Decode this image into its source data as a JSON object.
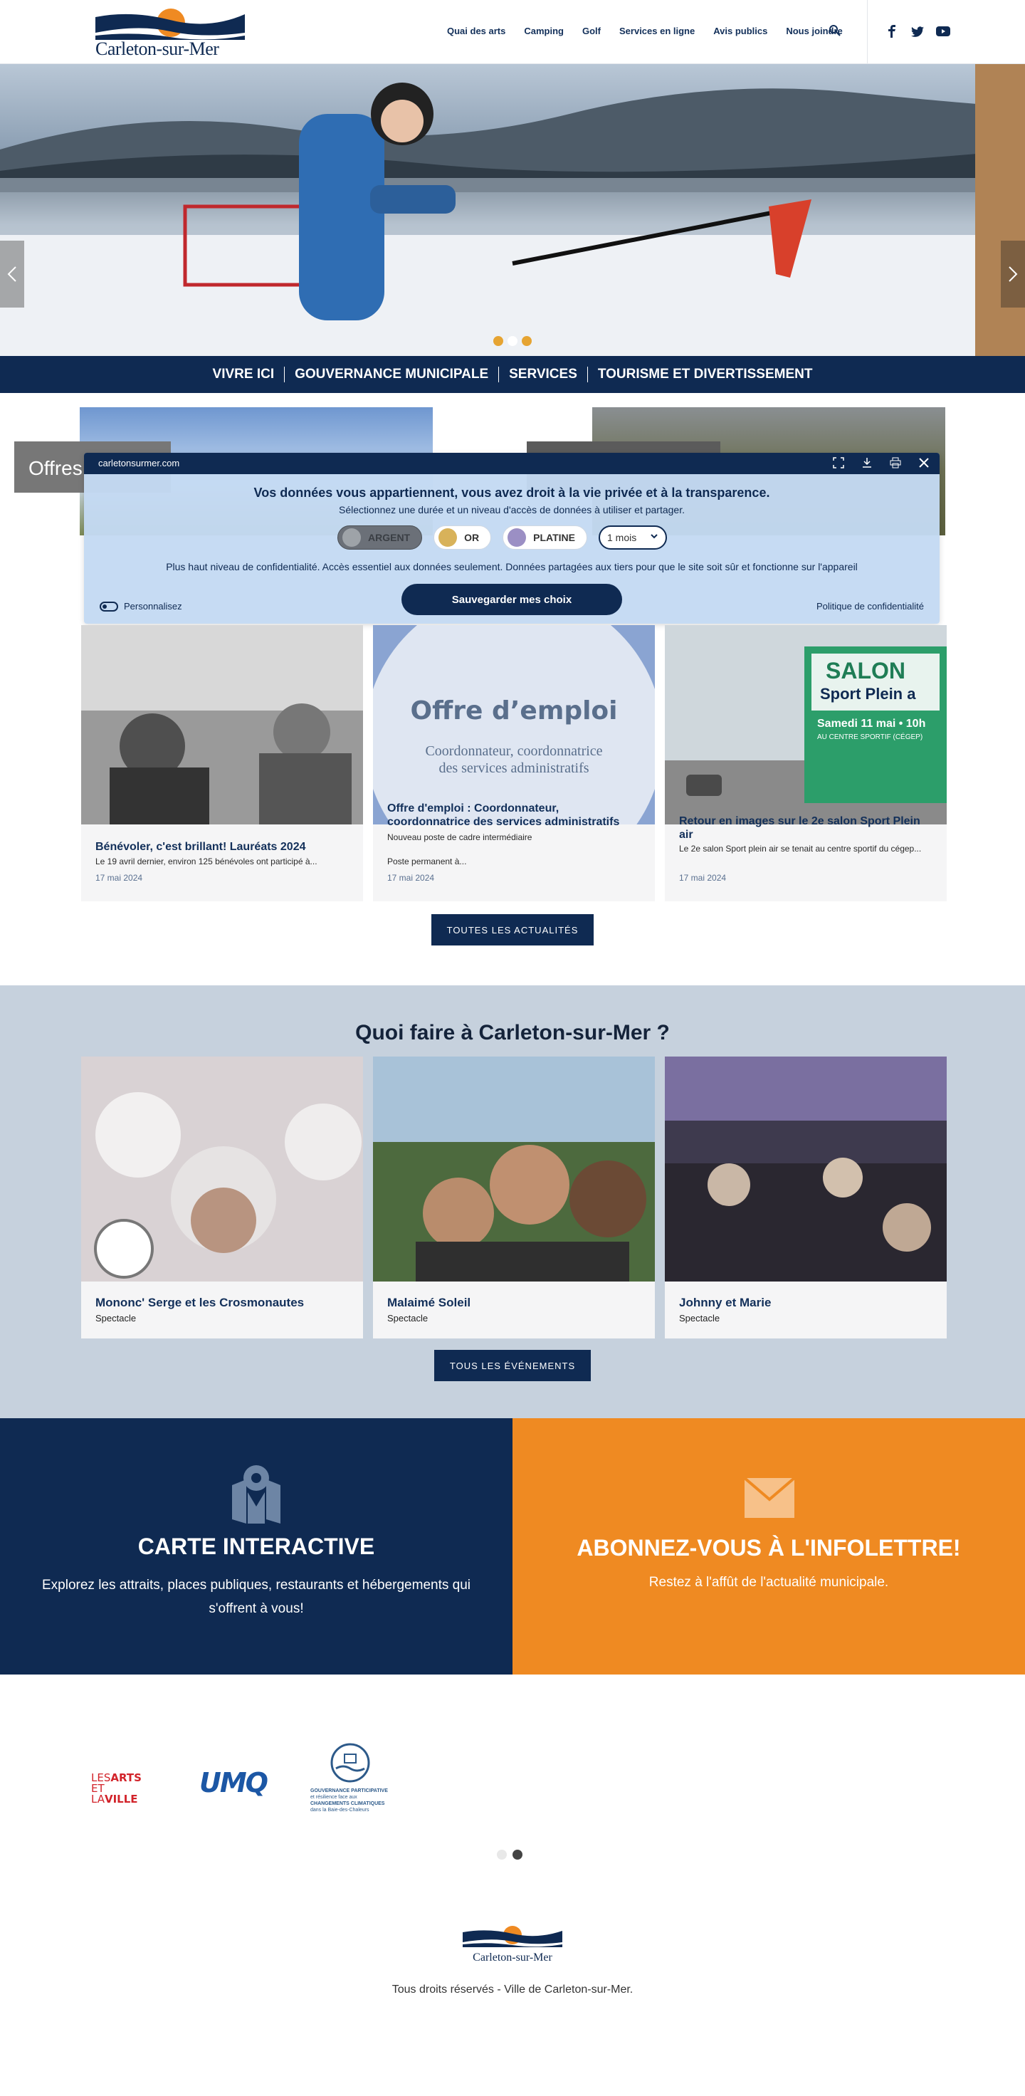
{
  "header": {
    "logo_text": "Carleton-sur-Mer",
    "nav": [
      "Quai des arts",
      "Camping",
      "Golf",
      "Services en ligne",
      "Avis publics",
      "Nous joindre"
    ],
    "social_icons": [
      "facebook-icon",
      "twitter-icon",
      "youtube-icon"
    ]
  },
  "hero": {
    "slides": 3,
    "active_slide": 2
  },
  "main_nav": [
    "VIVRE ICI",
    "GOUVERNANCE MUNICIPALE",
    "SERVICES",
    "TOURISME ET DIVERTISSEMENT"
  ],
  "offers": {
    "left_label": "Offres"
  },
  "cookie": {
    "domain": "carletonsurmer.com",
    "heading": "Vos données vous appartiennent, vous avez droit à la vie privée et à la transparence.",
    "subheading": "Sélectionnez une durée et un niveau d'accès de données à utiliser et partager.",
    "levels": [
      {
        "label": "ARGENT",
        "color": "#9ea3a8",
        "selected": true
      },
      {
        "label": "OR",
        "color": "#d8b25a",
        "selected": false
      },
      {
        "label": "PLATINE",
        "color": "#9b8fc4",
        "selected": false
      }
    ],
    "period": "1 mois",
    "description": "Plus haut niveau de confidentialité. Accès essentiel aux données seulement. Données partagées aux tiers pour que le site soit sûr et fonctionne sur l'appareil",
    "save_label": "Sauvegarder mes choix",
    "customize_label": "Personnalisez",
    "policy_label": "Politique de confidentialité"
  },
  "news": {
    "items": [
      {
        "title": "Bénévoler, c'est brillant! Lauréats 2024",
        "excerpt": "Le 19 avril dernier, environ 125 bénévoles ont participé à...",
        "date": "17 mai 2024"
      },
      {
        "title": "Offre d'emploi : Coordonnateur, coordonnatrice des services administratifs",
        "excerpt": "Nouveau poste de cadre intermédiaire",
        "excerpt2": "Poste permanent à...",
        "date": "17 mai 2024",
        "image_heading": "Offre d’emploi",
        "image_sub1": "Coordonnateur, coordonnatrice",
        "image_sub2": "des services administratifs"
      },
      {
        "title": "Retour en images sur le 2e salon Sport Plein air",
        "excerpt": "Le 2e salon Sport plein air se tenait au centre sportif du cégep...",
        "date": "17 mai 2024",
        "sign_title": "SALON",
        "sign_sub": "Sport Plein a",
        "sign_date": "Samedi 11 mai • 10h",
        "sign_place": "AU CENTRE SPORTIF (CÉGEP)"
      }
    ],
    "all_label": "TOUTES LES ACTUALITÉS"
  },
  "events": {
    "title": "Quoi faire à Carleton-sur-Mer ?",
    "items": [
      {
        "title": "Mononc' Serge et les Crosmonautes",
        "category": "Spectacle"
      },
      {
        "title": "Malaimé Soleil",
        "category": "Spectacle"
      },
      {
        "title": "Johnny et Marie",
        "category": "Spectacle"
      }
    ],
    "all_label": "TOUS LES ÉVÉNEMENTS"
  },
  "cta": {
    "map_title": "CARTE INTERACTIVE",
    "map_text": "Explorez les attraits, places publiques, restaurants et hébergements qui s'offrent à vous!",
    "newsletter_title": "ABONNEZ-VOUS À L'INFOLETTRE!",
    "newsletter_text": "Restez à l'affût de l'actualité municipale."
  },
  "partners": {
    "logo1_a": "LES",
    "logo1_b": "ARTS",
    "logo1_c": "ET LA",
    "logo1_d": "VILLE",
    "logo2": "UMQ",
    "logo3_lines": [
      "GOUVERNANCE PARTICIPATIVE",
      "et résilience face aux",
      "CHANGEMENTS CLIMATIQUES",
      "dans la Baie-des-Chaleurs"
    ],
    "active_page": 2
  },
  "footer": {
    "logo_text": "Carleton-sur-Mer",
    "copyright": "Tous droits réservés - Ville de Carleton-sur-Mer."
  },
  "colors": {
    "navy": "#0f2a52",
    "orange": "#ef8a22",
    "event_bg": "#c6d1dd"
  }
}
